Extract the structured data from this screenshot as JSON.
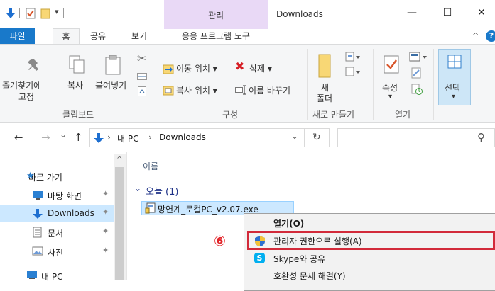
{
  "window": {
    "title": "Downloads",
    "contextual_tab_group": "관리",
    "controls": {
      "minimize": "—",
      "maximize": "☐",
      "close": "✕"
    }
  },
  "ribbon_tabs": [
    "파일",
    "홈",
    "공유",
    "보기",
    "응용 프로그램 도구"
  ],
  "ribbon": {
    "pin_label_1": "즐겨찾기에",
    "pin_label_2": "고정",
    "copy": "복사",
    "paste": "붙여넣기",
    "clipboard_group": "클립보드",
    "move_to": "이동 위치 ▾",
    "copy_to": "복사 위치 ▾",
    "delete": "삭제 ▾",
    "rename": "이름 바꾸기",
    "organize_group": "구성",
    "new_folder_1": "새",
    "new_folder_2": "폴더",
    "new_group": "새로 만들기",
    "properties": "속성",
    "properties_arrow": "▾",
    "open_group": "열기",
    "select": "선택",
    "select_arrow": "▾"
  },
  "address": {
    "back": "←",
    "forward": "→",
    "recent": "⌄",
    "up": "↑",
    "path_sep1": "›",
    "path_pc": "내 PC",
    "path_sep2": "›",
    "path_folder": "Downloads",
    "dropdown": "⌄",
    "refresh": "↻",
    "search_icon": "⚲"
  },
  "nav": {
    "quick_access": "바로 가기",
    "items": [
      {
        "label": "바탕 화면",
        "icon": "desktop-icon"
      },
      {
        "label": "Downloads",
        "icon": "download-icon"
      },
      {
        "label": "문서",
        "icon": "document-icon"
      },
      {
        "label": "사진",
        "icon": "pictures-icon"
      }
    ],
    "this_pc": "내 PC"
  },
  "content": {
    "column_name": "이름",
    "group_label": "오늘 (1)",
    "file_name": "망연계_로컬PC_v2.07.exe"
  },
  "context_menu": {
    "items": [
      "열기(O)",
      "관리자 권한으로 실행(A)",
      "Skype와 공유",
      "호환성 문제 해결(Y)"
    ]
  },
  "annotation": {
    "step_marker": "⑥",
    "highlight_color": "#d22a3a"
  },
  "colors": {
    "file_tab": "#1979ca",
    "contextual_band": "#e9d9f6",
    "selection": "#cce8ff",
    "folder_yellow": "#f8d775"
  }
}
